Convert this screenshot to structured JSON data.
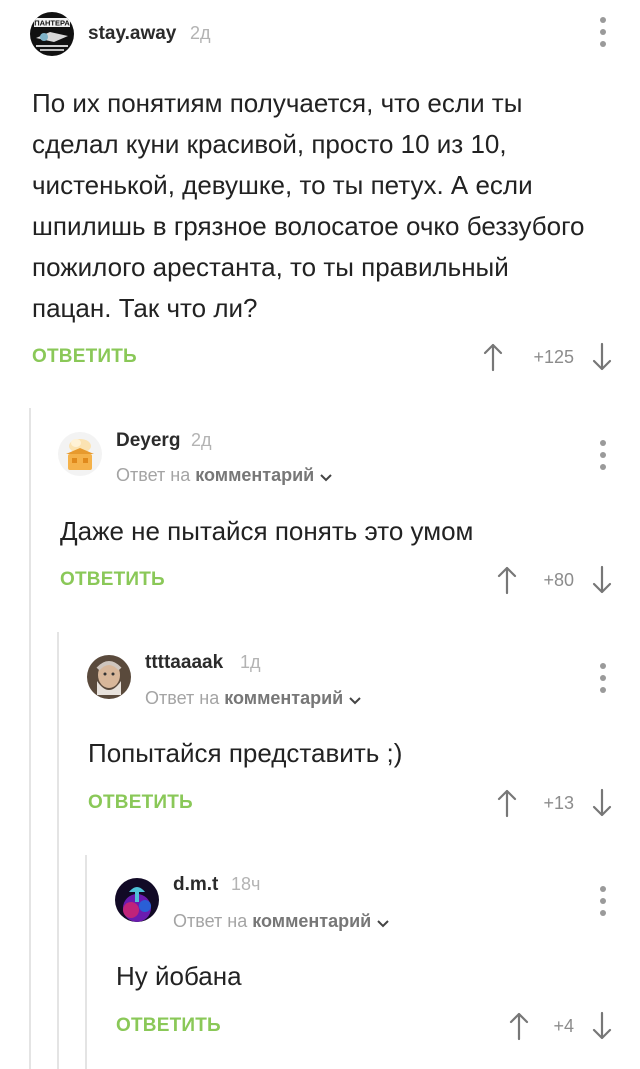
{
  "comments": [
    {
      "username": "stay.away",
      "time": "2д",
      "text": "По их понятиям получается, что если ты сделал куни красивой, просто 10 из 10, чистенькой, девушке, то ты петух. А если шпилишь в грязное волосатое очко беззубого пожилого арестанта, то ты правильный пацан. Так что ли?",
      "reply_label": "ОТВЕТИТЬ",
      "rating": "+125"
    },
    {
      "username": "Deyerg",
      "time": "2д",
      "reply_prefix": "Ответ на",
      "reply_target": "комментарий",
      "text": "Даже не пытайся понять это умом",
      "reply_label": "ОТВЕТИТЬ",
      "rating": "+80"
    },
    {
      "username": "ttttaaaak",
      "time": "1д",
      "reply_prefix": "Ответ на",
      "reply_target": "комментарий",
      "text": "Попытайся представить ;)",
      "reply_label": "ОТВЕТИТЬ",
      "rating": "+13"
    },
    {
      "username": "d.m.t",
      "time": "18ч",
      "reply_prefix": "Ответ на",
      "reply_target": "комментарий",
      "text": "Ну йобана",
      "reply_label": "ОТВЕТИТЬ",
      "rating": "+4"
    }
  ],
  "avatar_1_text": "ПАНТЕРА",
  "colors": {
    "accent_green": "#8ac858",
    "muted_text": "#a4a4a4",
    "thread_line": "#e4e4e4"
  },
  "icons": [
    "more-vertical-icon",
    "upvote-arrow-icon",
    "downvote-arrow-icon",
    "chevron-down-icon"
  ]
}
